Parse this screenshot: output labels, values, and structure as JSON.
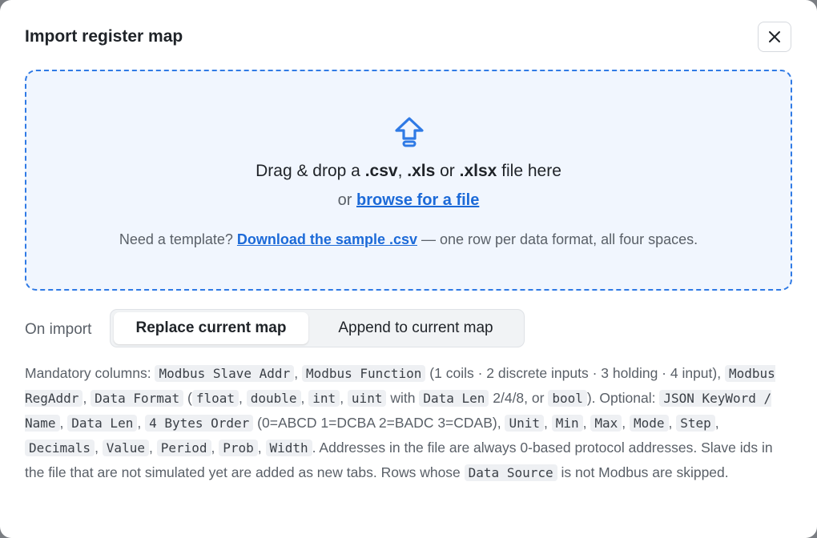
{
  "dialog": {
    "title": "Import register map",
    "close_icon": "close-icon"
  },
  "dropzone": {
    "icon": "upload-arrow-icon",
    "drag_prefix": "Drag & drop a ",
    "ext_csv": ".csv",
    "comma": ", ",
    "ext_xls": ".xls",
    "or_word": " or ",
    "ext_xlsx": ".xlsx",
    "drag_suffix": " file here",
    "or_label": "or ",
    "browse_link": "browse for a file",
    "template_prefix": "Need a template? ",
    "template_link": "Download the sample .csv",
    "template_suffix": " — one row per data format, all four spaces."
  },
  "on_import": {
    "label": "On import",
    "options": [
      "Replace current map",
      "Append to current map"
    ],
    "selected": "Replace current map"
  },
  "help": {
    "t1": "Mandatory columns: ",
    "c1": "Modbus Slave Addr",
    "t2": ", ",
    "c2": "Modbus Function",
    "t3": " (1 coils · 2 discrete inputs · 3 holding · 4 input), ",
    "c3": "Modbus RegAddr",
    "t4": ", ",
    "c4": "Data Format",
    "t5": " (",
    "c5": "float",
    "t6": ", ",
    "c6": "double",
    "t7": ", ",
    "c7": "int",
    "t8": ", ",
    "c8": "uint",
    "t9": " with ",
    "c9": "Data Len",
    "t10": " 2/4/8, or ",
    "c10": "bool",
    "t11": "). Optional: ",
    "c11": "JSON KeyWord / Name",
    "t12": ", ",
    "c12": "Data Len",
    "t13": ", ",
    "c13": "4 Bytes Order",
    "t14": " (0=ABCD 1=DCBA 2=BADC 3=CDAB), ",
    "c14": "Unit",
    "t15": ", ",
    "c15": "Min",
    "t16": ", ",
    "c16": "Max",
    "t17": ", ",
    "c17": "Mode",
    "t18": ", ",
    "c18": "Step",
    "t19": ", ",
    "c19": "Decimals",
    "t20": ", ",
    "c20": "Value",
    "t21": ", ",
    "c21": "Period",
    "t22": ", ",
    "c22": "Prob",
    "t23": ", ",
    "c23": "Width",
    "t24": ". Addresses in the file are always 0-based protocol addresses. Slave ids in the file that are not simulated yet are added as new tabs. Rows whose ",
    "c24": "Data Source",
    "t25": " is not Modbus are skipped."
  },
  "colors": {
    "accent": "#2f7ae5",
    "link": "#1c6ad8",
    "dropzone_bg": "#f1f6fe",
    "muted_text": "#5a6068"
  }
}
